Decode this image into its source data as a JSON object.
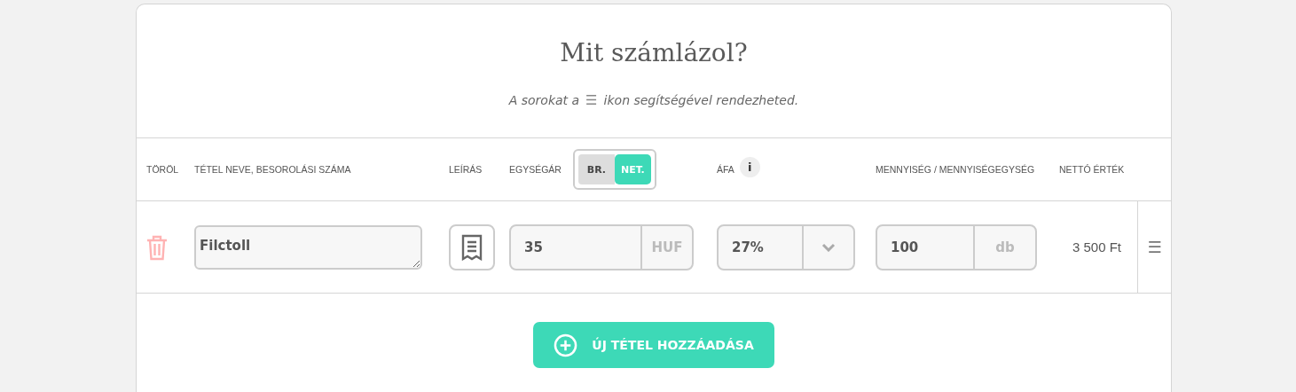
{
  "title": "Mit számlázol?",
  "hint": {
    "before": "A sorokat a",
    "icon": "☰",
    "after": "ikon segítségével rendezheted."
  },
  "columns": {
    "delete": "TÖRÖL",
    "name": "TÉTEL NEVE, BESOROLÁSI SZÁMA",
    "description": "LEÍRÁS",
    "unit_price": "EGYSÉGÁR",
    "vat": "ÁFA",
    "vat_info": "i",
    "quantity": "MENNYISÉG / MENNYISÉGEGYSÉG",
    "net": "NETTÓ ÉRTÉK"
  },
  "price_mode": [
    {
      "label": "BR.",
      "selected": false
    },
    {
      "label": "NET.",
      "selected": true
    }
  ],
  "rows": [
    {
      "name": "Filctoll",
      "unit_price": "35",
      "currency": "HUF",
      "vat": "27%",
      "quantity": "100",
      "unit": "db",
      "net": "3 500 Ft",
      "handle": "☰"
    }
  ],
  "add_button": "ÚJ TÉTEL HOZZÁADÁSA"
}
